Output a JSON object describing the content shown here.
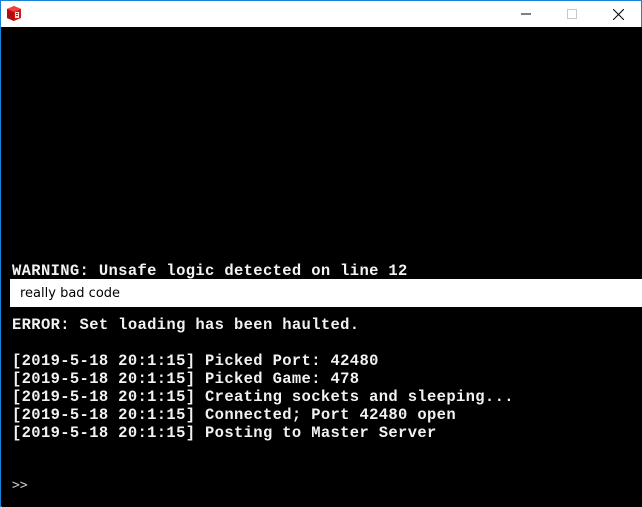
{
  "window": {
    "title": "",
    "app_icon": "red-cube-app-icon",
    "border_color": "#1883d7",
    "controls": {
      "minimize_icon": "minimize-icon",
      "maximize_icon": "maximize-icon",
      "close_icon": "close-icon"
    }
  },
  "console": {
    "warning_line": "WARNING: Unsafe logic detected on line 12",
    "code_snippet": "really bad code",
    "error_line": "ERROR: Set loading has been haulted.",
    "log_lines": [
      "[2019-5-18 20:1:15] Picked Port: 42480",
      "[2019-5-18 20:1:15] Picked Game: 478",
      "[2019-5-18 20:1:15] Creating sockets and sleeping...",
      "[2019-5-18 20:1:15] Connected; Port 42480 open",
      "[2019-5-18 20:1:15] Posting to Master Server"
    ],
    "prompt": ">>",
    "input_value": ""
  },
  "colors": {
    "background": "#000000",
    "text": "#f2f2f2",
    "highlight_bar": "#ffffff"
  }
}
